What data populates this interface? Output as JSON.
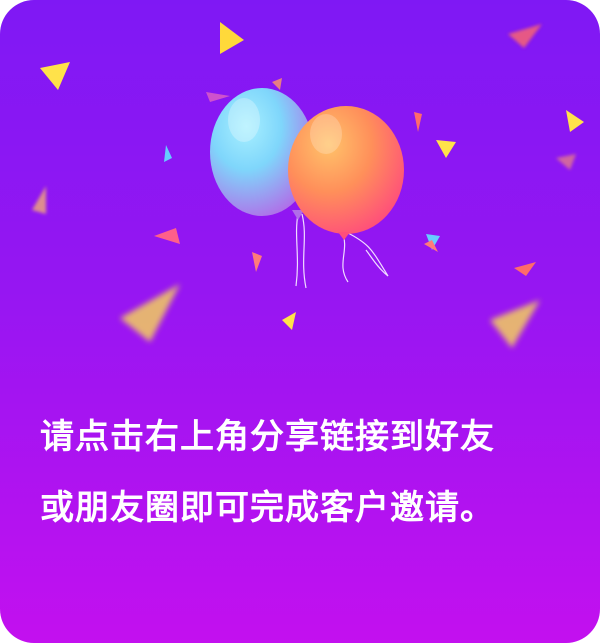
{
  "message": {
    "line1": "请点击右上角分享链接到好友",
    "line2": "或朋友圈即可完成客户邀请。"
  },
  "colors": {
    "background_top": "#7f18f4",
    "background_bottom": "#c310ef",
    "text": "#ffffff",
    "balloon_blue": "#7fd9ff",
    "balloon_orange": "#ff9a4d"
  },
  "icons": [
    "balloon-icon",
    "confetti-icon"
  ]
}
